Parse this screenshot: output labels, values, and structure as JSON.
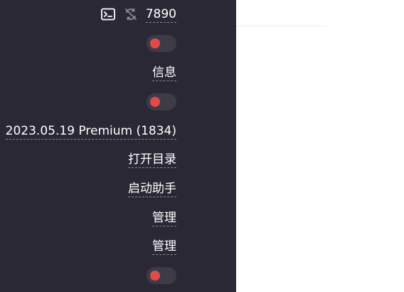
{
  "header": {
    "terminal_icon": "terminal-icon",
    "sync_disabled_icon": "sync-off-icon",
    "port": "7890"
  },
  "rows": {
    "info_label": "信息",
    "version": "2023.05.19 Premium (1834)",
    "open_directory": "打开目录",
    "launch_helper": "启动助手",
    "manage_1": "管理",
    "manage_2": "管理"
  },
  "toggles": {
    "toggle_1": "off",
    "toggle_2": "off",
    "toggle_3": "off"
  },
  "colors": {
    "panel_bg": "#2b2836",
    "toggle_bg": "#3d3b45",
    "knob_off": "#e04a4a",
    "text": "#ffffff"
  }
}
